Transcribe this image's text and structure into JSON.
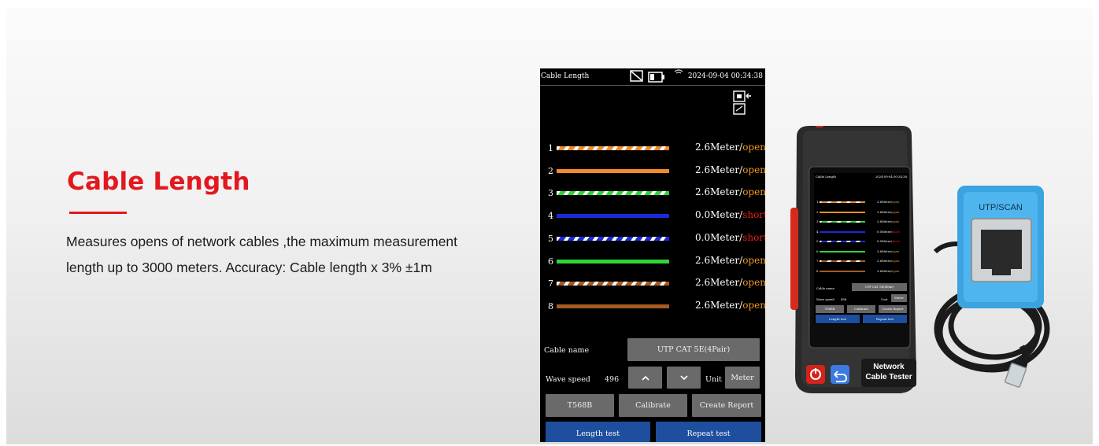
{
  "headline": "Cable Length",
  "description_line1": "Measures opens of network cables ,the maximum measurement",
  "description_line2": "length up to 3000 meters. Accuracy: Cable length x 3% ±1m",
  "screen": {
    "title": "Cable Length",
    "timestamp": "2024-09-04 00:34:38",
    "wires": [
      {
        "num": "1",
        "length": "2.6Meter/",
        "status": "open",
        "pattern": "orange-white"
      },
      {
        "num": "2",
        "length": "2.6Meter/",
        "status": "open",
        "pattern": "orange"
      },
      {
        "num": "3",
        "length": "2.6Meter/",
        "status": "open",
        "pattern": "green-white"
      },
      {
        "num": "4",
        "length": "0.0Meter/",
        "status": "short",
        "pattern": "blue"
      },
      {
        "num": "5",
        "length": "0.0Meter/",
        "status": "short",
        "pattern": "blue-white"
      },
      {
        "num": "6",
        "length": "2.6Meter/",
        "status": "open",
        "pattern": "green"
      },
      {
        "num": "7",
        "length": "2.6Meter/",
        "status": "open",
        "pattern": "brown-white"
      },
      {
        "num": "8",
        "length": "2.6Meter/",
        "status": "open",
        "pattern": "brown"
      }
    ],
    "cable_name_label": "Cable name",
    "cable_name_value": "UTP CAT 5E(4Pair)",
    "wave_speed_label": "Wave speed",
    "wave_speed_value": "496",
    "unit_label": "Unit",
    "unit_value": "Meter",
    "t568b_label": "T568B",
    "calibrate_label": "Calibrate",
    "create_report_label": "Create Report",
    "length_test_label": "Length test",
    "repeat_test_label": "Repeat test"
  },
  "device": {
    "brand_line1": "Network",
    "brand_line2": "Cable Tester",
    "adapter_label": "UTP/SCAN",
    "mini_screen": {
      "title": "Cable Length",
      "timestamp": "2024-09-04 00:34:38",
      "wires": [
        {
          "num": "1",
          "length": "2.6Meter/",
          "status": "open"
        },
        {
          "num": "2",
          "length": "2.6Meter/",
          "status": "open"
        },
        {
          "num": "3",
          "length": "2.6Meter/",
          "status": "open"
        },
        {
          "num": "4",
          "length": "0.0Meter/",
          "status": "short"
        },
        {
          "num": "5",
          "length": "0.0Meter/",
          "status": "short"
        },
        {
          "num": "6",
          "length": "2.6Meter/",
          "status": "open"
        },
        {
          "num": "7",
          "length": "2.6Meter/",
          "status": "open"
        },
        {
          "num": "8",
          "length": "2.6Meter/",
          "status": "open"
        }
      ],
      "cable_name_label": "Cable name",
      "cable_name_value": "UTP CAT 5E(4Pair)",
      "wave_speed_label": "Wave speed",
      "wave_speed_value": "496",
      "unit_label": "Unit",
      "unit_value": "Meter",
      "t568b_label": "T568B",
      "calibrate_label": "Calibrate",
      "create_report_label": "Create Report",
      "length_test_label": "Length test",
      "repeat_test_label": "Repeat test"
    }
  },
  "colors": {
    "accent": "#e3181f",
    "open": "#f29a1f",
    "short": "#e0201c",
    "button": "#6a6a6a",
    "button_blue": "#1e4e9e"
  },
  "icons": [
    "no-signal-icon",
    "battery-icon",
    "wifi-icon",
    "port-icon",
    "power-icon",
    "back-icon"
  ]
}
